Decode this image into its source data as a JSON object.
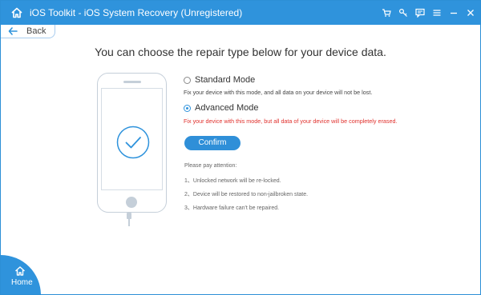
{
  "window": {
    "title": "iOS Toolkit - iOS System Recovery (Unregistered)"
  },
  "titlebar_icons": [
    "home-icon",
    "cart-icon",
    "key-icon",
    "feedback-icon",
    "menu-icon",
    "minimize-icon",
    "close-icon"
  ],
  "back": {
    "label": "Back"
  },
  "heading": "You can choose the repair type below for your device data.",
  "modes": [
    {
      "label": "Standard Mode",
      "selected": false,
      "description": "Fix your device with this mode, and all data on your device will not be lost."
    },
    {
      "label": "Advanced Mode",
      "selected": true,
      "description": "Fix your device with this mode, but all data of your device will be completely erased."
    }
  ],
  "confirm_label": "Confirm",
  "attention": {
    "title": "Please pay attention:",
    "items": [
      "1、Unlocked network will be re-locked.",
      "2、Device will be restored to non-jailbroken state.",
      "3、Hardware failure can't be repaired."
    ]
  },
  "home": {
    "label": "Home"
  },
  "colors": {
    "accent": "#2f93dc",
    "warning": "#e0302c"
  }
}
